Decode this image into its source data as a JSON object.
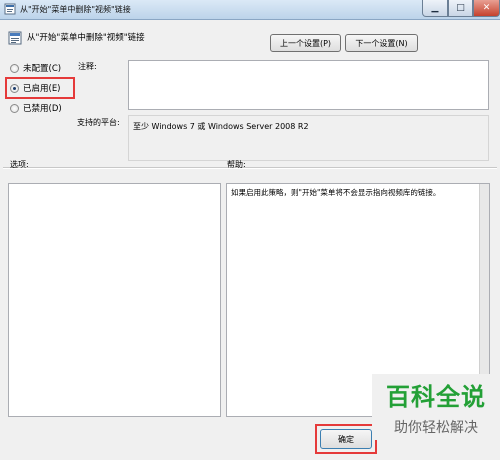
{
  "window": {
    "title": "从\"开始\"菜单中删除\"视频\"链接",
    "minimize_glyph": "▁",
    "maximize_glyph": "□",
    "close_glyph": "✕"
  },
  "header": {
    "policy_title": "从\"开始\"菜单中删除\"视频\"链接",
    "prev_button": "上一个设置(P)",
    "next_button": "下一个设置(N)"
  },
  "options": {
    "not_configured": "未配置(C)",
    "enabled": "已启用(E)",
    "disabled": "已禁用(D)",
    "selected": "enabled"
  },
  "labels": {
    "comment": "注释:",
    "supported_on": "支持的平台:",
    "options": "选项:",
    "help": "帮助:"
  },
  "supported_platform": "至少 Windows 7 或 Windows Server 2008 R2",
  "comment_value": "",
  "help_text": "如果启用此策略，则\"开始\"菜单将不会显示指向视频库的链接。",
  "footer": {
    "ok_button": "确定"
  },
  "watermark": {
    "main": "百科全说",
    "sub": "助你轻松解决"
  },
  "colors": {
    "highlight": "#e53a3a",
    "watermark_green": "#23a036"
  }
}
